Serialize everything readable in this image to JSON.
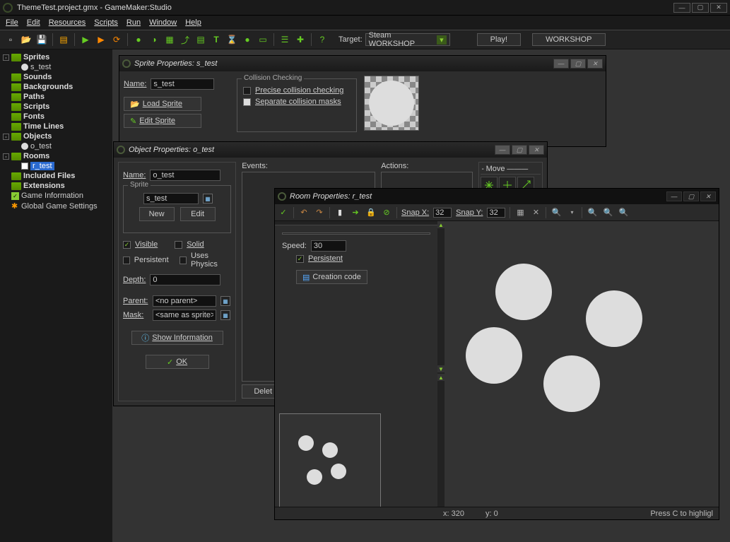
{
  "window": {
    "title": "ThemeTest.project.gmx - GameMaker:Studio"
  },
  "menu": [
    "File",
    "Edit",
    "Resources",
    "Scripts",
    "Run",
    "Window",
    "Help"
  ],
  "toolbar": {
    "target_label": "Target:",
    "target_value": "Steam WORKSHOP",
    "play": "Play!",
    "workshop": "WORKSHOP"
  },
  "tree": {
    "sprites": "Sprites",
    "s_test": "s_test",
    "sounds": "Sounds",
    "backgrounds": "Backgrounds",
    "paths": "Paths",
    "scripts": "Scripts",
    "fonts": "Fonts",
    "timelines": "Time Lines",
    "objects": "Objects",
    "o_test": "o_test",
    "rooms": "Rooms",
    "r_test": "r_test",
    "included": "Included Files",
    "extensions": "Extensions",
    "gameinfo": "Game Information",
    "global": "Global Game Settings"
  },
  "sprite_win": {
    "title": "Sprite Properties: s_test",
    "name_lbl": "Name:",
    "name_val": "s_test",
    "load": "Load Sprite",
    "edit": "Edit Sprite",
    "collision_legend": "Collision Checking",
    "precise": "Precise collision checking",
    "separate": "Separate collision masks"
  },
  "object_win": {
    "title": "Object Properties: o_test",
    "name_lbl": "Name:",
    "name_val": "o_test",
    "sprite_legend": "Sprite",
    "sprite_val": "s_test",
    "new": "New",
    "edit": "Edit",
    "visible": "Visible",
    "solid": "Solid",
    "persistent": "Persistent",
    "physics": "Uses Physics",
    "depth_lbl": "Depth:",
    "depth_val": "0",
    "parent_lbl": "Parent:",
    "parent_val": "<no parent>",
    "mask_lbl": "Mask:",
    "mask_val": "<same as sprite>",
    "showinfo": "Show Information",
    "ok": "OK",
    "delete": "Delet",
    "events_lbl": "Events:",
    "actions_lbl": "Actions:",
    "move_lbl": "Move",
    "move_tab": "move"
  },
  "room_win": {
    "title": "Room Properties: r_test",
    "snapx_lbl": "Snap X:",
    "snapx_val": "32",
    "snapy_lbl": "Snap Y:",
    "snapy_val": "32",
    "speed_lbl": "Speed:",
    "speed_val": "30",
    "persistent": "Persistent",
    "creation": "Creation code",
    "status_x": "x: 320",
    "status_y": "y: 0",
    "status_hint": "Press C to highligl"
  }
}
